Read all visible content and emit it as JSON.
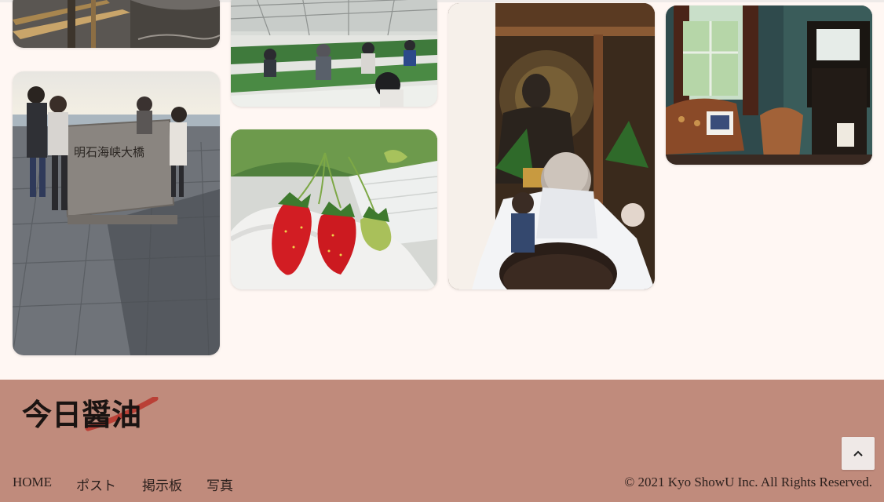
{
  "logo": {
    "text": "今日醤油",
    "accent_color": "#b8322a"
  },
  "nav": {
    "items": [
      {
        "label": "HOME"
      },
      {
        "label": "ポスト"
      },
      {
        "label": "掲示板"
      },
      {
        "label": "写真"
      }
    ]
  },
  "copyright": "© 2021 Kyo ShowU Inc. All Rights Reserved.",
  "back_to_top": {
    "icon": "chevron-up-icon"
  },
  "photos": [
    {
      "subject": "bridge-cable-photo"
    },
    {
      "subject": "strawberry-greenhouse-photo"
    },
    {
      "subject": "great-buddha-photo"
    },
    {
      "subject": "victorian-parlor-photo"
    },
    {
      "subject": "akashi-bridge-monument-photo",
      "sign_text": "明石海峡大橋"
    },
    {
      "subject": "strawberries-in-hand-photo"
    }
  ],
  "colors": {
    "page_bg": "#fff7f3",
    "footer_bg": "#c08b7c",
    "text": "#2a1f1c"
  }
}
